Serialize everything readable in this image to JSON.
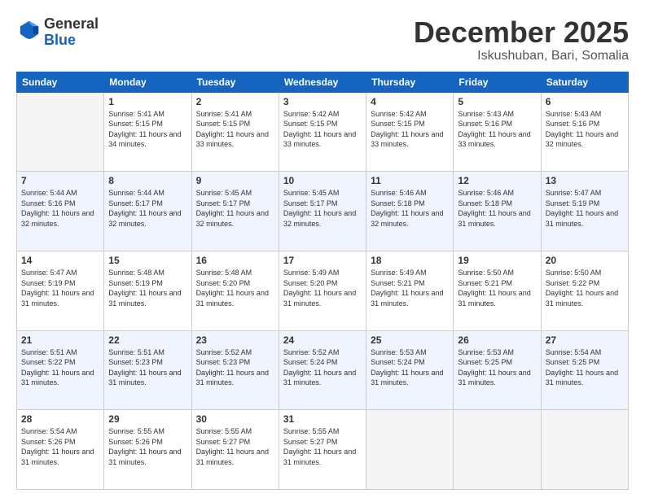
{
  "logo": {
    "general": "General",
    "blue": "Blue"
  },
  "header": {
    "month": "December 2025",
    "location": "Iskushuban, Bari, Somalia"
  },
  "weekdays": [
    "Sunday",
    "Monday",
    "Tuesday",
    "Wednesday",
    "Thursday",
    "Friday",
    "Saturday"
  ],
  "weeks": [
    [
      {
        "day": "",
        "empty": true
      },
      {
        "day": "1",
        "sunrise": "Sunrise: 5:41 AM",
        "sunset": "Sunset: 5:15 PM",
        "daylight": "Daylight: 11 hours and 34 minutes."
      },
      {
        "day": "2",
        "sunrise": "Sunrise: 5:41 AM",
        "sunset": "Sunset: 5:15 PM",
        "daylight": "Daylight: 11 hours and 33 minutes."
      },
      {
        "day": "3",
        "sunrise": "Sunrise: 5:42 AM",
        "sunset": "Sunset: 5:15 PM",
        "daylight": "Daylight: 11 hours and 33 minutes."
      },
      {
        "day": "4",
        "sunrise": "Sunrise: 5:42 AM",
        "sunset": "Sunset: 5:15 PM",
        "daylight": "Daylight: 11 hours and 33 minutes."
      },
      {
        "day": "5",
        "sunrise": "Sunrise: 5:43 AM",
        "sunset": "Sunset: 5:16 PM",
        "daylight": "Daylight: 11 hours and 33 minutes."
      },
      {
        "day": "6",
        "sunrise": "Sunrise: 5:43 AM",
        "sunset": "Sunset: 5:16 PM",
        "daylight": "Daylight: 11 hours and 32 minutes."
      }
    ],
    [
      {
        "day": "7",
        "sunrise": "Sunrise: 5:44 AM",
        "sunset": "Sunset: 5:16 PM",
        "daylight": "Daylight: 11 hours and 32 minutes."
      },
      {
        "day": "8",
        "sunrise": "Sunrise: 5:44 AM",
        "sunset": "Sunset: 5:17 PM",
        "daylight": "Daylight: 11 hours and 32 minutes."
      },
      {
        "day": "9",
        "sunrise": "Sunrise: 5:45 AM",
        "sunset": "Sunset: 5:17 PM",
        "daylight": "Daylight: 11 hours and 32 minutes."
      },
      {
        "day": "10",
        "sunrise": "Sunrise: 5:45 AM",
        "sunset": "Sunset: 5:17 PM",
        "daylight": "Daylight: 11 hours and 32 minutes."
      },
      {
        "day": "11",
        "sunrise": "Sunrise: 5:46 AM",
        "sunset": "Sunset: 5:18 PM",
        "daylight": "Daylight: 11 hours and 32 minutes."
      },
      {
        "day": "12",
        "sunrise": "Sunrise: 5:46 AM",
        "sunset": "Sunset: 5:18 PM",
        "daylight": "Daylight: 11 hours and 31 minutes."
      },
      {
        "day": "13",
        "sunrise": "Sunrise: 5:47 AM",
        "sunset": "Sunset: 5:19 PM",
        "daylight": "Daylight: 11 hours and 31 minutes."
      }
    ],
    [
      {
        "day": "14",
        "sunrise": "Sunrise: 5:47 AM",
        "sunset": "Sunset: 5:19 PM",
        "daylight": "Daylight: 11 hours and 31 minutes."
      },
      {
        "day": "15",
        "sunrise": "Sunrise: 5:48 AM",
        "sunset": "Sunset: 5:19 PM",
        "daylight": "Daylight: 11 hours and 31 minutes."
      },
      {
        "day": "16",
        "sunrise": "Sunrise: 5:48 AM",
        "sunset": "Sunset: 5:20 PM",
        "daylight": "Daylight: 11 hours and 31 minutes."
      },
      {
        "day": "17",
        "sunrise": "Sunrise: 5:49 AM",
        "sunset": "Sunset: 5:20 PM",
        "daylight": "Daylight: 11 hours and 31 minutes."
      },
      {
        "day": "18",
        "sunrise": "Sunrise: 5:49 AM",
        "sunset": "Sunset: 5:21 PM",
        "daylight": "Daylight: 11 hours and 31 minutes."
      },
      {
        "day": "19",
        "sunrise": "Sunrise: 5:50 AM",
        "sunset": "Sunset: 5:21 PM",
        "daylight": "Daylight: 11 hours and 31 minutes."
      },
      {
        "day": "20",
        "sunrise": "Sunrise: 5:50 AM",
        "sunset": "Sunset: 5:22 PM",
        "daylight": "Daylight: 11 hours and 31 minutes."
      }
    ],
    [
      {
        "day": "21",
        "sunrise": "Sunrise: 5:51 AM",
        "sunset": "Sunset: 5:22 PM",
        "daylight": "Daylight: 11 hours and 31 minutes."
      },
      {
        "day": "22",
        "sunrise": "Sunrise: 5:51 AM",
        "sunset": "Sunset: 5:23 PM",
        "daylight": "Daylight: 11 hours and 31 minutes."
      },
      {
        "day": "23",
        "sunrise": "Sunrise: 5:52 AM",
        "sunset": "Sunset: 5:23 PM",
        "daylight": "Daylight: 11 hours and 31 minutes."
      },
      {
        "day": "24",
        "sunrise": "Sunrise: 5:52 AM",
        "sunset": "Sunset: 5:24 PM",
        "daylight": "Daylight: 11 hours and 31 minutes."
      },
      {
        "day": "25",
        "sunrise": "Sunrise: 5:53 AM",
        "sunset": "Sunset: 5:24 PM",
        "daylight": "Daylight: 11 hours and 31 minutes."
      },
      {
        "day": "26",
        "sunrise": "Sunrise: 5:53 AM",
        "sunset": "Sunset: 5:25 PM",
        "daylight": "Daylight: 11 hours and 31 minutes."
      },
      {
        "day": "27",
        "sunrise": "Sunrise: 5:54 AM",
        "sunset": "Sunset: 5:25 PM",
        "daylight": "Daylight: 11 hours and 31 minutes."
      }
    ],
    [
      {
        "day": "28",
        "sunrise": "Sunrise: 5:54 AM",
        "sunset": "Sunset: 5:26 PM",
        "daylight": "Daylight: 11 hours and 31 minutes."
      },
      {
        "day": "29",
        "sunrise": "Sunrise: 5:55 AM",
        "sunset": "Sunset: 5:26 PM",
        "daylight": "Daylight: 11 hours and 31 minutes."
      },
      {
        "day": "30",
        "sunrise": "Sunrise: 5:55 AM",
        "sunset": "Sunset: 5:27 PM",
        "daylight": "Daylight: 11 hours and 31 minutes."
      },
      {
        "day": "31",
        "sunrise": "Sunrise: 5:55 AM",
        "sunset": "Sunset: 5:27 PM",
        "daylight": "Daylight: 11 hours and 31 minutes."
      },
      {
        "day": "",
        "empty": true
      },
      {
        "day": "",
        "empty": true
      },
      {
        "day": "",
        "empty": true
      }
    ]
  ]
}
